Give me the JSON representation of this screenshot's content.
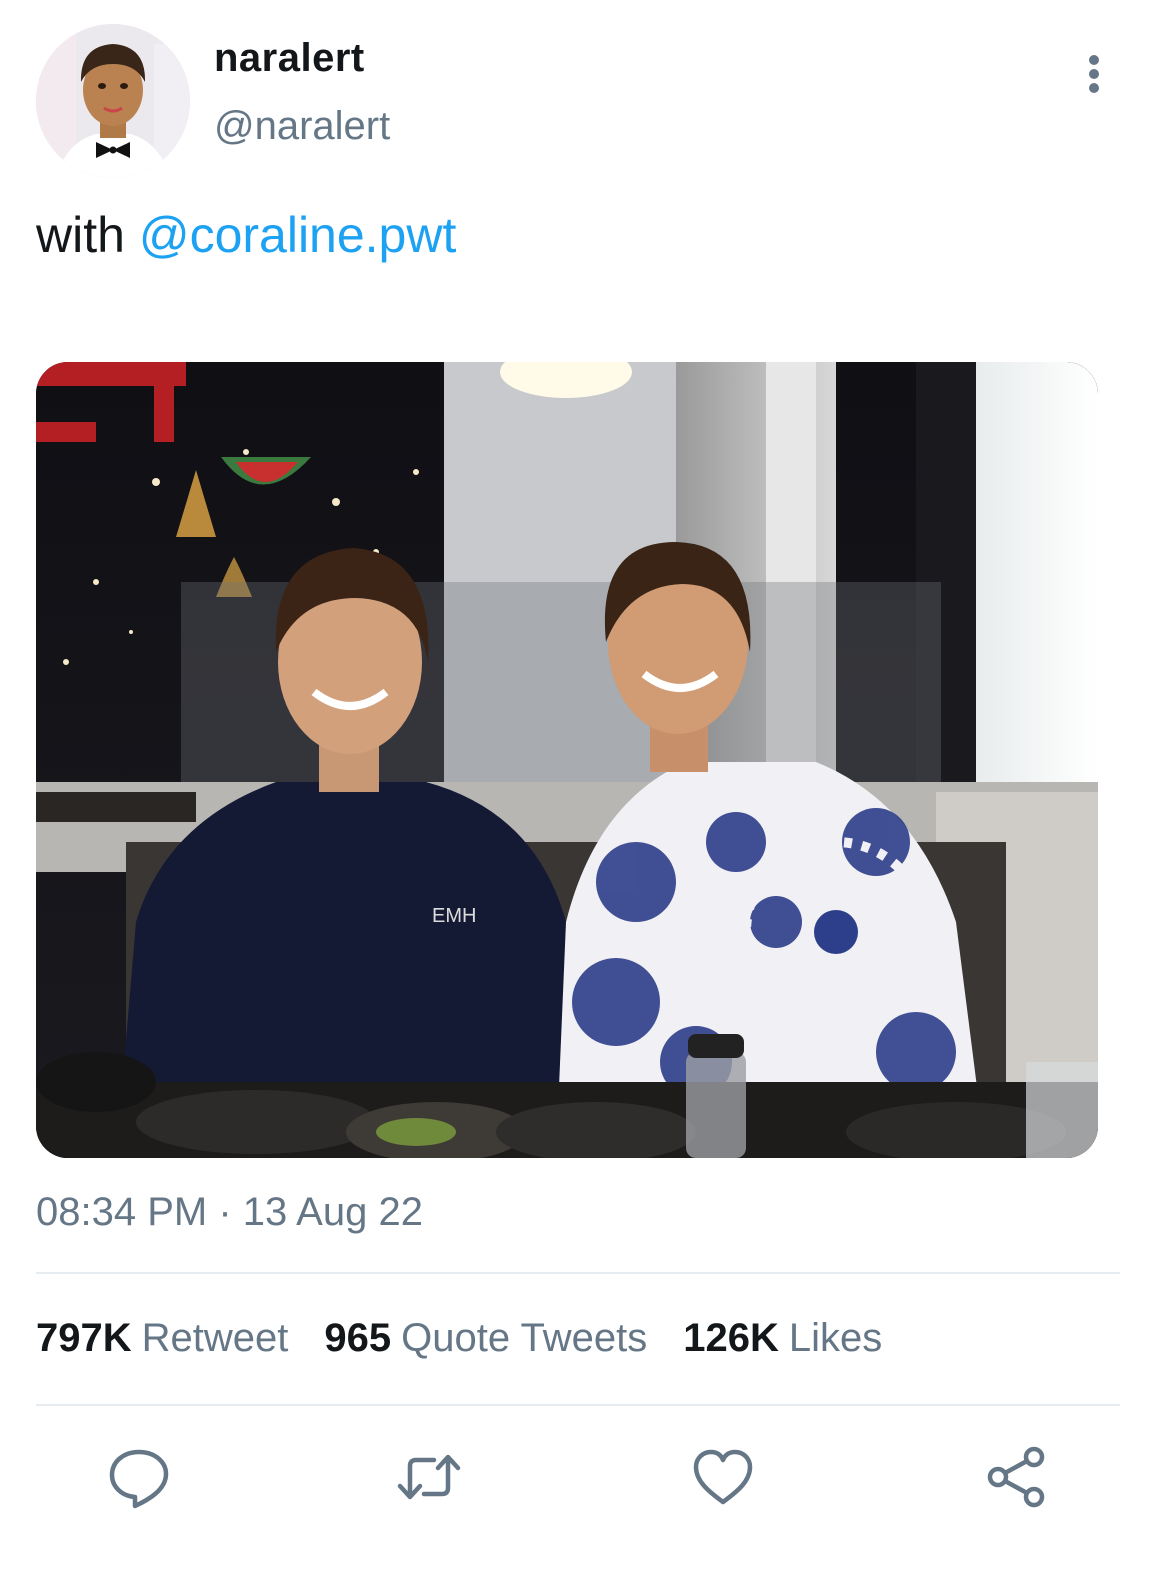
{
  "author": {
    "display_name": "naralert",
    "handle": "@naralert",
    "avatar_icon": "avatar-illustration"
  },
  "tweet": {
    "text_prefix": "with ",
    "mention": "@coraline.pwt",
    "media_icon": "photo",
    "timestamp": "08:34 PM · 13 Aug 22"
  },
  "stats": {
    "retweets": {
      "count": "797K",
      "label": "Retweet"
    },
    "quotes": {
      "count": "965",
      "label": "Quote Tweets"
    },
    "likes": {
      "count": "126K",
      "label": "Likes"
    }
  },
  "actions": {
    "icons": [
      "reply-icon",
      "retweet-icon",
      "like-icon",
      "share-icon"
    ]
  },
  "colors": {
    "accent": "#1da1f2",
    "text_primary": "#14171a",
    "text_secondary": "#657786",
    "icon": "#657786",
    "divider": "#e6ecf0"
  }
}
